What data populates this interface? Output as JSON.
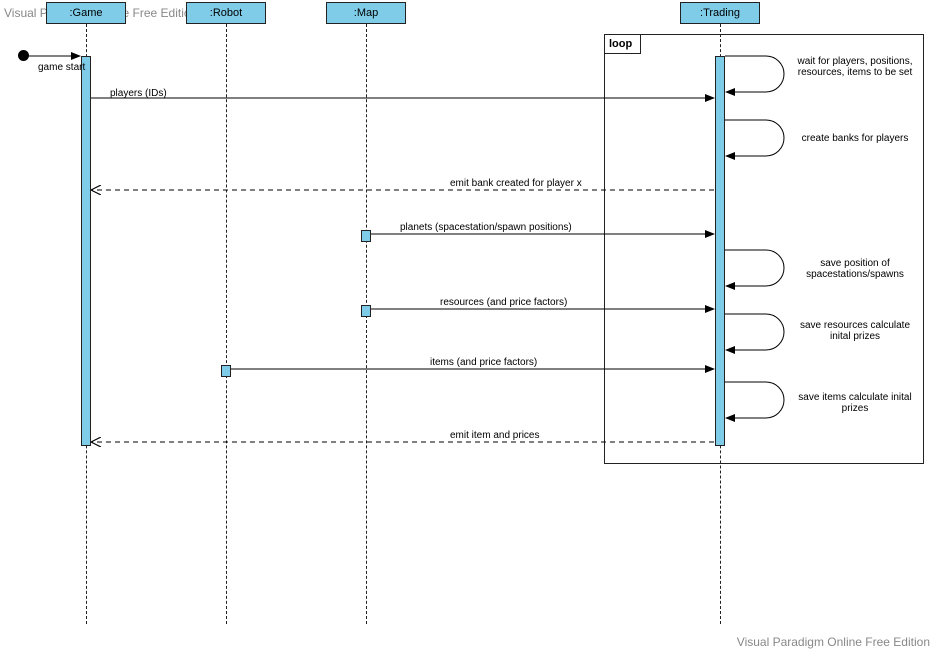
{
  "watermark": "Visual Paradigm Online Free Edition",
  "lifelines": {
    "game": ":Game",
    "robot": ":Robot",
    "map": ":Map",
    "trading": ":Trading"
  },
  "frame_label": "loop",
  "start_label": "game start",
  "messages": {
    "players": "players (IDs)",
    "wait": "wait for players,\npositions, resources, items\nto be set",
    "create_banks": "create banks for players",
    "emit_bank": "emit bank created for player x",
    "planets": "planets (spacestation/spawn positions)",
    "save_pos": "save position of\nspacestations/spawns",
    "resources": "resources (and price factors)",
    "save_res": "save resources\ncalculate inital prizes",
    "items": "items (and price factors)",
    "save_items": "save items\ncalculate inital prizes",
    "emit_items": "emit item and prices"
  }
}
